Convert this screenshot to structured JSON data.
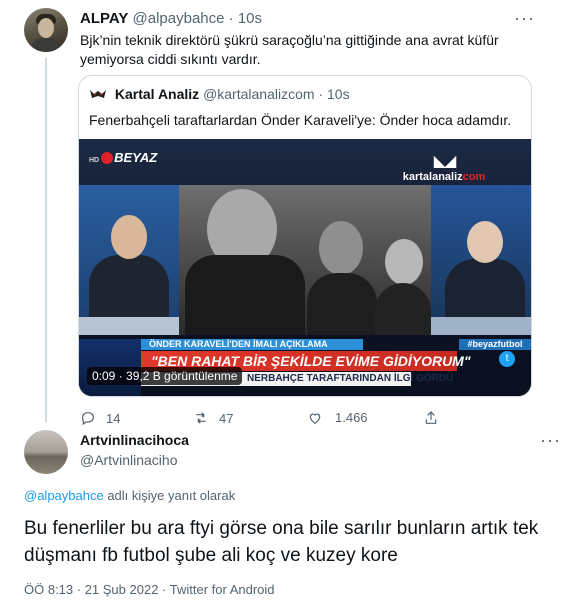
{
  "tweet1": {
    "display_name": "ALPAY",
    "handle": "@alpaybahce",
    "separator": "·",
    "time": "10s",
    "text": "Bjk’nin teknik direktörü şükrü saraçoğlu’na gittiğinde ana avrat küfür yemiyorsa ciddi sıkıntı vardır.",
    "more_icon": "more-icon"
  },
  "quote": {
    "display_name": "Kartal Analiz",
    "handle": "@kartalanalizcom",
    "separator": "·",
    "time": "10s",
    "text": "Fenerbahçeli taraftarlardan Önder Karaveli'ye: Önder hoca adamdır.",
    "video": {
      "channel_hd": "HD",
      "channel": "BEYAZ",
      "watermark_eyes": "◣◢",
      "watermark_brand_a": "kartalanaliz",
      "watermark_brand_b": "com",
      "banner_top": "ÖNDER KARAVELİ'DEN İMALI AÇIKLAMA",
      "hashtag": "#beyazfutbol",
      "banner_main": "\"BEN RAHAT BİR ŞEKİLDE EVİME GİDİYORUM\"",
      "banner_sub": "NERBAHÇE TARAFTARINDAN İLGİ GÖRDÜ",
      "twitter_glyph": "t",
      "views": "0:09 · 39,2 B görüntülenme"
    }
  },
  "actions": {
    "reply_count": "14",
    "retweet_count": "47",
    "like_count": "",
    "view_count": "1.466"
  },
  "tweet2": {
    "display_name": "Artvinlinacihoca",
    "handle": "@Artvinlinaciho",
    "reply_to_handle": "@alpaybahce",
    "reply_suffix": " adlı kişiye yanıt olarak",
    "text": "Bu fenerliler bu ara ftyi görse ona bile sarılır bunların artık tek düşmanı fb futbol şube ali koç ve kuzey kore",
    "meta": "ÖÖ 8:13 · 21 Şub 2022 · Twitter for Android"
  },
  "colors": {
    "accent": "#1d9bf0",
    "muted": "#536471",
    "text": "#0f1419",
    "border": "#cfd9de"
  }
}
